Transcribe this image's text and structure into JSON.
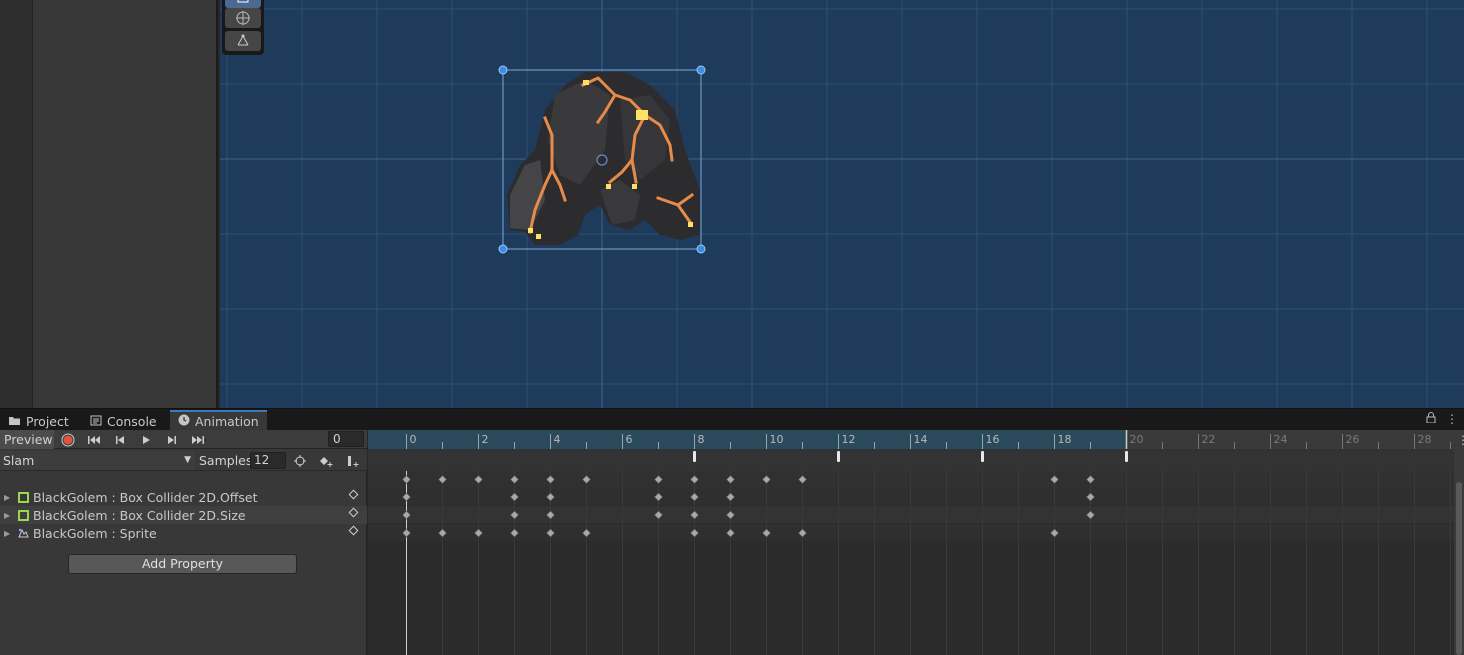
{
  "tabs": [
    {
      "label": "Project",
      "icon": "folder-icon",
      "active": false
    },
    {
      "label": "Console",
      "icon": "console-icon",
      "active": false
    },
    {
      "label": "Animation",
      "icon": "clock-icon",
      "active": true
    }
  ],
  "toolbar": {
    "preview_label": "Preview",
    "current_frame": "0"
  },
  "clip": {
    "name": "Slam",
    "samples_label": "Samples",
    "samples_value": "12"
  },
  "properties": [
    {
      "label": "BlackGolem : Box Collider 2D.Offset",
      "icon": "box-collider-icon"
    },
    {
      "label": "BlackGolem : Box Collider 2D.Size",
      "icon": "box-collider-icon"
    },
    {
      "label": "BlackGolem : Sprite",
      "icon": "sprite-renderer-icon"
    }
  ],
  "add_property_label": "Add Property",
  "timeline": {
    "ruler_labels": [
      "0",
      "2",
      "4",
      "6",
      "8",
      "10",
      "12",
      "14",
      "16",
      "18",
      "20",
      "22",
      "24",
      "26",
      "28"
    ],
    "clip_end_frame": 20,
    "event_frames": [
      8,
      12,
      16,
      20
    ],
    "summary_keys": [
      0,
      1,
      2,
      3,
      4,
      5,
      7,
      8,
      9,
      10,
      11,
      18,
      19
    ],
    "rows": [
      {
        "keys": [
          0,
          3,
          4,
          7,
          8,
          9,
          19
        ]
      },
      {
        "keys": [
          0,
          3,
          4,
          7,
          8,
          9,
          19
        ]
      },
      {
        "keys": [
          0,
          1,
          2,
          3,
          4,
          5,
          8,
          9,
          10,
          11,
          18
        ]
      }
    ]
  },
  "colors": {
    "scene_bg": "#1f3b5c",
    "record_red": "#e0533c",
    "timeline_active": "#2b4a5c",
    "collider_green": "#9bd94a"
  }
}
